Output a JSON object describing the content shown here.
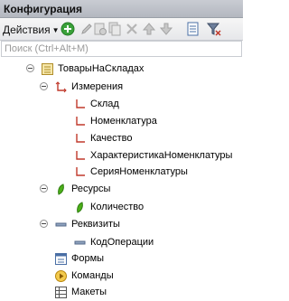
{
  "window": {
    "title": "Конфигурация"
  },
  "toolbar": {
    "actions_label": "Действия",
    "buttons": [
      "add-icon",
      "edit-icon",
      "add-child-icon",
      "copy-icon",
      "delete-icon",
      "move-up-icon",
      "move-down-icon",
      "properties-icon",
      "filter-icon"
    ]
  },
  "search": {
    "placeholder": "Поиск (Ctrl+Alt+M)"
  },
  "tree": {
    "root": "ТоварыНаСкладах",
    "dimensions": {
      "label": "Измерения",
      "items": [
        "Склад",
        "Номенклатура",
        "Качество",
        "ХарактеристикаНоменклатуры",
        "СерияНоменклатуры"
      ]
    },
    "resources": {
      "label": "Ресурсы",
      "items": [
        "Количество"
      ]
    },
    "attributes": {
      "label": "Реквизиты",
      "items": [
        "КодОперации"
      ]
    },
    "forms": "Формы",
    "commands": "Команды",
    "layouts": "Макеты"
  },
  "colors": {
    "accent_green": "#3aa13a",
    "dimension_red": "#c0392b",
    "resource_green": "#4caf1a"
  }
}
